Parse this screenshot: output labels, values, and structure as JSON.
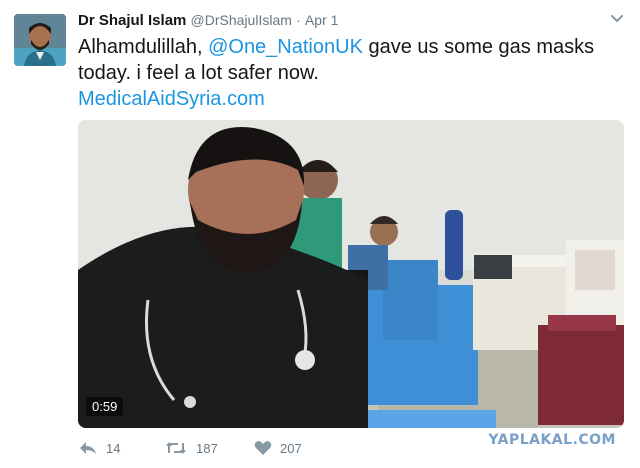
{
  "author": {
    "display_name": "Dr Shajul Islam",
    "handle": "@DrShajulIslam",
    "separator": "·",
    "date": "Apr 1"
  },
  "text": {
    "part1": "Alhamdulillah, ",
    "mention": "@One_NationUK",
    "part2": " gave us some gas masks today. i feel a lot safer now.",
    "link": "MedicalAidSyria.com"
  },
  "media": {
    "duration": "0:59"
  },
  "actions": {
    "replies": "14",
    "retweets": "187",
    "likes": "207"
  },
  "watermark": "YAPLAKAL.COM",
  "colors": {
    "link": "#1b95e0",
    "meta": "#657786",
    "watermark": "#7aa0c8"
  }
}
